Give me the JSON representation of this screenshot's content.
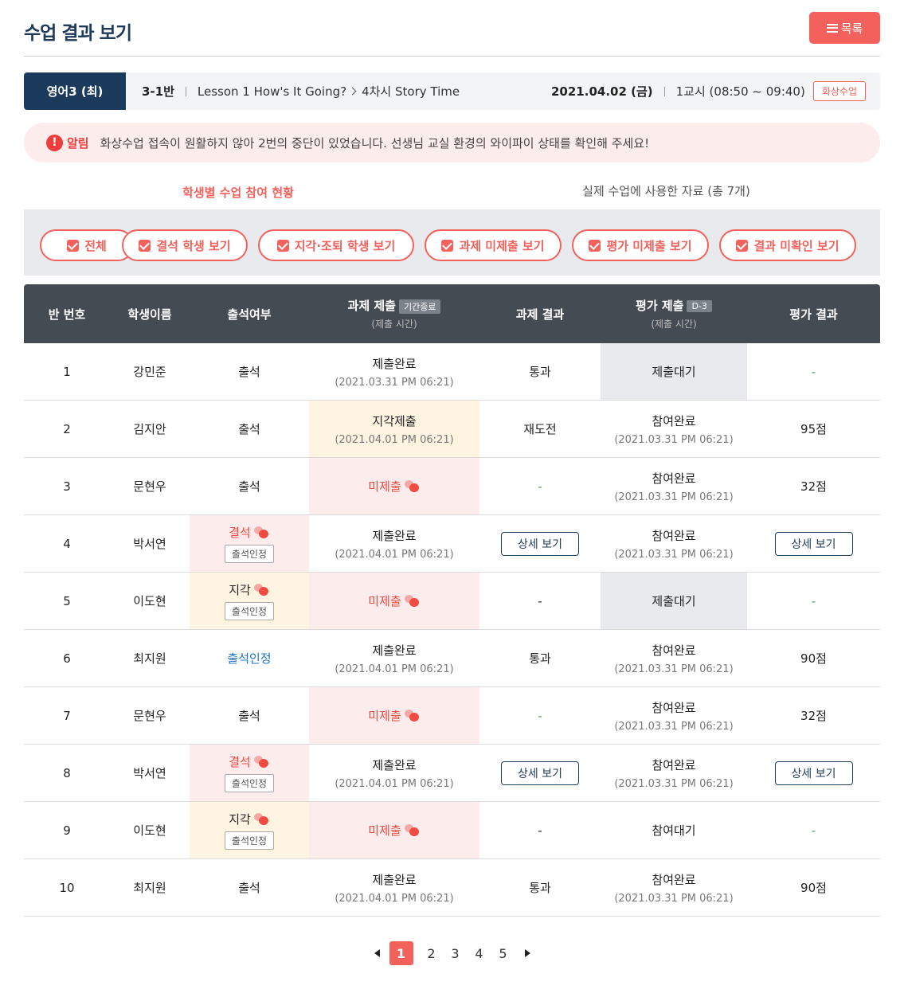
{
  "page": {
    "title": "수업 결과 보기",
    "list_button": "목록"
  },
  "info": {
    "subject": "영어3 (최)",
    "class": "3-1반",
    "lesson": "Lesson 1 How's It Going?",
    "session": "4차시 Story Time",
    "date": "2021.04.02 (금)",
    "period": "1교시 (08:50 ~ 09:40)",
    "mode_badge": "화상수업"
  },
  "alert": {
    "icon": "!",
    "label": "알림",
    "message": "화상수업 접속이 원활하지 않아 2번의 중단이 있었습니다. 선생님 교실 환경의 와이파이 상태를 확인해 주세요!"
  },
  "tabs": [
    "학생별 수업 참여 현황",
    "실제 수업에 사용한 자료 (총 7개)"
  ],
  "filters": [
    "전체",
    "결석 학생 보기",
    "지각·조퇴 학생 보기",
    "과제 미제출 보기",
    "평가 미제출 보기",
    "결과 미확인 보기"
  ],
  "table": {
    "headers": {
      "number": "반 번호",
      "name": "학생이름",
      "attendance": "출석여부",
      "assignment": "과제 제출",
      "assignment_tag": "기간종료",
      "assignment_sub": "(제출 시간)",
      "assignment_result": "과제 결과",
      "evaluation": "평가 제출",
      "evaluation_tag": "D-3",
      "evaluation_sub": "(제출 시간)",
      "evaluation_result": "평가 결과"
    },
    "rows": [
      {
        "num": "1",
        "name": "강민준",
        "att": "출석",
        "att_badge": "",
        "assign": "제출완료",
        "assign_time": "(2021.03.31 PM 06:21)",
        "assign_result": "통과",
        "eval": "제출대기",
        "eval_time": "",
        "eval_result": "-"
      },
      {
        "num": "2",
        "name": "김지안",
        "att": "출석",
        "att_badge": "",
        "assign": "지각제출",
        "assign_time": "(2021.04.01 PM 06:21)",
        "assign_result": "재도전",
        "eval": "참여완료",
        "eval_time": "(2021.03.31 PM 06:21)",
        "eval_result": "95점"
      },
      {
        "num": "3",
        "name": "문현우",
        "att": "출석",
        "att_badge": "",
        "assign": "미제출",
        "assign_time": "",
        "assign_result": "-",
        "eval": "참여완료",
        "eval_time": "(2021.03.31 PM 06:21)",
        "eval_result": "32점"
      },
      {
        "num": "4",
        "name": "박서연",
        "att": "결석",
        "att_badge": "출석인정",
        "assign": "제출완료",
        "assign_time": "(2021.04.01 PM 06:21)",
        "assign_result": "상세 보기",
        "eval": "참여완료",
        "eval_time": "(2021.03.31 PM 06:21)",
        "eval_result": "상세 보기"
      },
      {
        "num": "5",
        "name": "이도현",
        "att": "지각",
        "att_badge": "출석인정",
        "assign": "미제출",
        "assign_time": "",
        "assign_result": "-",
        "eval": "제출대기",
        "eval_time": "",
        "eval_result": "-"
      },
      {
        "num": "6",
        "name": "최지원",
        "att": "출석인정",
        "att_badge": "",
        "assign": "제출완료",
        "assign_time": "(2021.04.01 PM 06:21)",
        "assign_result": "통과",
        "eval": "참여완료",
        "eval_time": "(2021.03.31 PM 06:21)",
        "eval_result": "90점"
      },
      {
        "num": "7",
        "name": "문현우",
        "att": "출석",
        "att_badge": "",
        "assign": "미제출",
        "assign_time": "",
        "assign_result": "-",
        "eval": "참여완료",
        "eval_time": "(2021.03.31 PM 06:21)",
        "eval_result": "32점"
      },
      {
        "num": "8",
        "name": "박서연",
        "att": "결석",
        "att_badge": "출석인정",
        "assign": "제출완료",
        "assign_time": "(2021.04.01 PM 06:21)",
        "assign_result": "상세 보기",
        "eval": "참여완료",
        "eval_time": "(2021.03.31 PM 06:21)",
        "eval_result": "상세 보기"
      },
      {
        "num": "9",
        "name": "이도현",
        "att": "지각",
        "att_badge": "출석인정",
        "assign": "미제출",
        "assign_time": "",
        "assign_result": "-",
        "eval": "참여대기",
        "eval_time": "",
        "eval_result": "-"
      },
      {
        "num": "10",
        "name": "최지원",
        "att": "출석",
        "att_badge": "",
        "assign": "제출완료",
        "assign_time": "(2021.04.01 PM 06:21)",
        "assign_result": "통과",
        "eval": "참여완료",
        "eval_time": "(2021.03.31 PM 06:21)",
        "eval_result": "90점"
      }
    ]
  },
  "pagination": {
    "pages": [
      "1",
      "2",
      "3",
      "4",
      "5"
    ],
    "current": "1"
  },
  "colors": {
    "accent": "#f2615b",
    "navy": "#1b3a5c",
    "header": "#454b52",
    "alert_bg": "#fdecec"
  },
  "icons": {
    "list": "hamburger-icon",
    "alert": "exclamation-circle-icon",
    "chat": "chat-bubble-icon",
    "check": "checkbox-checked-icon"
  }
}
